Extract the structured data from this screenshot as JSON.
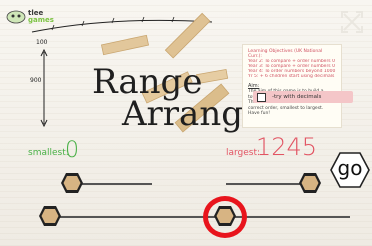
{
  "logo": {
    "line1": "tlee",
    "line2": "games"
  },
  "title": {
    "line1": "Range",
    "line2": "Arranger"
  },
  "info": {
    "objectives_title": "Learning Objectives (UK National Curr.):",
    "objective_lines": [
      "Year 2: To compare + order numbers 0 - 100",
      "Year 3: To compare + order numbers 0 - 1 0…",
      "Year 4: To order numbers beyond 1000",
      "Yr 5: + 6 children start using decimals"
    ],
    "aim_title": "Aim:",
    "aim_text": "The aim of this game is to build a tower tall enough to reach into space. The blocks must be stacked in the correct order, smallest to largest. Have fun!",
    "decimals_label": "-try with decimals"
  },
  "smallest": {
    "label": "smallest:",
    "value": "0"
  },
  "largest": {
    "label": "largest:",
    "value": "1245"
  },
  "go_label": "go",
  "colors": {
    "smallest": "#49b046",
    "largest": "#e25463",
    "highlight": "#e8141c",
    "hex_fill": "#d7b483",
    "hex_stroke": "#222222"
  }
}
